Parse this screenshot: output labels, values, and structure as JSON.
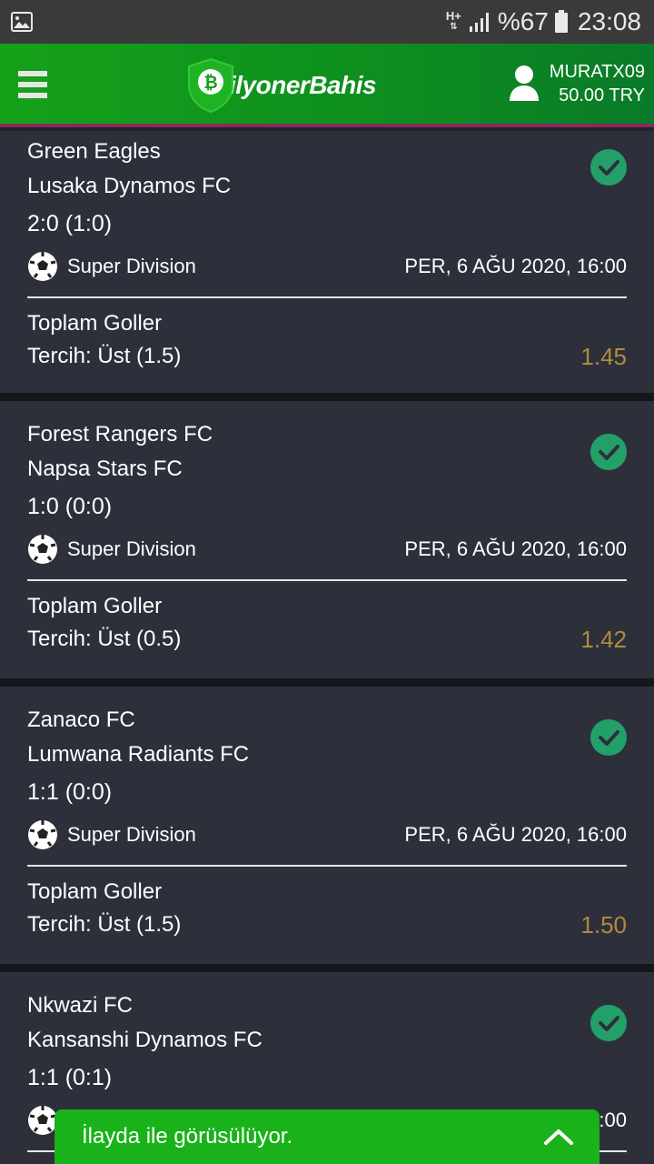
{
  "status_bar": {
    "network": "H+",
    "battery": "%67",
    "time": "23:08"
  },
  "header": {
    "logo_text": "ilyonerBahis",
    "username": "MURATX09",
    "balance": "50.00 TRY"
  },
  "bets": [
    {
      "home": "Green Eagles",
      "away": "Lusaka Dynamos FC",
      "score": "2:0 (1:0)",
      "league": "Super Division",
      "datetime": "PER, 6 AĞU 2020, 16:00",
      "market": "Toplam Goller",
      "pick": "Tercih: Üst (1.5)",
      "odd": "1.45",
      "status": "won"
    },
    {
      "home": "Forest Rangers FC",
      "away": "Napsa Stars FC",
      "score": "1:0 (0:0)",
      "league": "Super Division",
      "datetime": "PER, 6 AĞU 2020, 16:00",
      "market": "Toplam Goller",
      "pick": "Tercih: Üst (0.5)",
      "odd": "1.42",
      "status": "won"
    },
    {
      "home": "Zanaco FC",
      "away": "Lumwana Radiants FC",
      "score": "1:1 (0:0)",
      "league": "Super Division",
      "datetime": "PER, 6 AĞU 2020, 16:00",
      "market": "Toplam Goller",
      "pick": "Tercih: Üst (1.5)",
      "odd": "1.50",
      "status": "won"
    },
    {
      "home": "Nkwazi FC",
      "away": "Kansanshi Dynamos FC",
      "score": "1:1 (0:1)",
      "league": "",
      "datetime": ":00",
      "status": "won"
    }
  ],
  "chat": {
    "label": "İlayda ile görüsülüyor."
  },
  "colors": {
    "header_green": "#16a11a",
    "card_bg": "#2d303b",
    "check_green": "#23a06a",
    "odd_gold": "#b08a3e",
    "chat_green": "#19b21a"
  }
}
